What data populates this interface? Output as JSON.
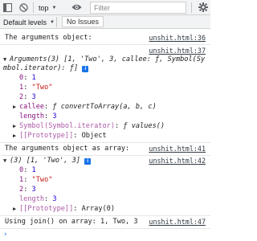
{
  "toolbar": {
    "context": "top",
    "filter_placeholder": "Filter",
    "levels": "Default levels",
    "levels_arrow": "▼",
    "issues": "No Issues"
  },
  "console": {
    "msg1": {
      "text": "The arguments object:",
      "source": "unshit.html:36"
    },
    "msg2_source": "unshit.html:37",
    "args_summary_1": "Arguments(3) [1, 'Two', 3, callee: ƒ, Symbol(Sy",
    "args_summary_2": "mbol.iterator): ƒ]",
    "args_props": [
      {
        "key": "0",
        "value": "1",
        "type": "num"
      },
      {
        "key": "1",
        "value": "\"Two\"",
        "type": "str"
      },
      {
        "key": "2",
        "value": "3",
        "type": "num"
      }
    ],
    "callee_key": "callee",
    "callee_value": "ƒ convertToArray(a, b, c)",
    "length_key": "length",
    "length_value": "3",
    "symbol_key": "Symbol(Symbol.iterator)",
    "symbol_value": "ƒ values()",
    "proto1_key": "[[Prototype]]",
    "proto1_value": "Object",
    "msg3": {
      "text": "The arguments object as array:",
      "source": "unshit.html:41"
    },
    "msg4_source": "unshit.html:42",
    "arr_summary": "(3) [1, 'Two', 3]",
    "arr_props": [
      {
        "key": "0",
        "value": "1",
        "type": "num"
      },
      {
        "key": "1",
        "value": "\"Two\"",
        "type": "str"
      },
      {
        "key": "2",
        "value": "3",
        "type": "num"
      }
    ],
    "arr_length_key": "length",
    "arr_length_value": "3",
    "proto2_key": "[[Prototype]]",
    "proto2_value": "Array(0)",
    "msg5": {
      "text": "Using join() on array:  1, Two, 3",
      "source": "unshit.html:47"
    },
    "prompt": "›"
  },
  "colors": {
    "link_blue": "#1a73e8",
    "number": "#1c00cf",
    "string": "#c41a16",
    "key": "#881280"
  }
}
